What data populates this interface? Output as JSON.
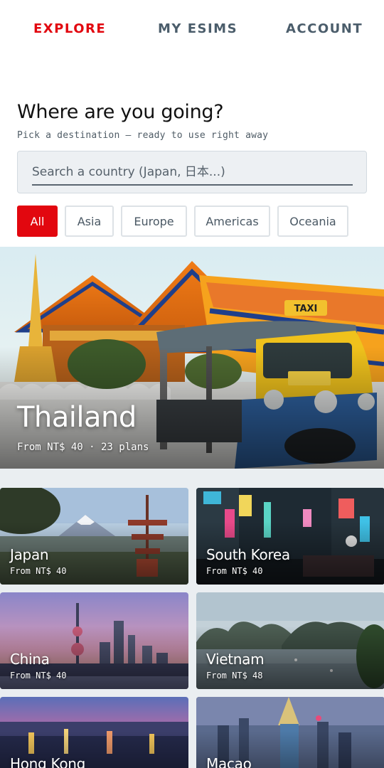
{
  "nav": {
    "tabs": [
      {
        "label": "EXPLORE",
        "active": true
      },
      {
        "label": "MY ESIMS",
        "active": false
      },
      {
        "label": "ACCOUNT",
        "active": false
      }
    ]
  },
  "header": {
    "title": "Where are you going?",
    "subtitle": "Pick a destination — ready to use right away"
  },
  "search": {
    "placeholder": "Search a country (Japan, 日本...)",
    "value": ""
  },
  "filters": {
    "options": [
      "All",
      "Asia",
      "Europe",
      "Americas",
      "Oceania"
    ],
    "selected": "All"
  },
  "featured": {
    "name": "Thailand",
    "details": "From NT$ 40 · 23 plans",
    "image_icon": "tuk-tuk-temple-photo"
  },
  "destinations": [
    {
      "name": "Japan",
      "price": "From NT$ 40",
      "image_icon": "mount-fuji-pagoda-photo"
    },
    {
      "name": "South Korea",
      "price": "From NT$ 40",
      "image_icon": "neon-street-photo"
    },
    {
      "name": "China",
      "price": "From NT$ 40",
      "image_icon": "shanghai-skyline-photo"
    },
    {
      "name": "Vietnam",
      "price": "From NT$ 48",
      "image_icon": "halong-bay-photo"
    },
    {
      "name": "Hong Kong",
      "price": "",
      "image_icon": "harbour-night-photo"
    },
    {
      "name": "Macao",
      "price": "",
      "image_icon": "casino-tower-photo"
    }
  ],
  "colors": {
    "accent": "#e2070f",
    "nav_inactive": "#4b5d6b",
    "grid_background": "#eaeef1"
  }
}
